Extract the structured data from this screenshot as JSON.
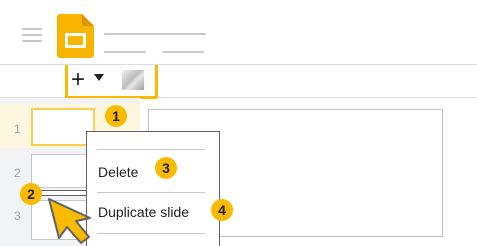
{
  "toolbar": {
    "new_slide_label": "+",
    "new_slide_menu_icon": "caret-down-icon",
    "layout_icon": "layout-thumbnail-icon"
  },
  "header": {
    "menu_icon": "hamburger-icon",
    "app_icon": "slides-logo-icon"
  },
  "filmstrip": {
    "slides": [
      {
        "number": "1"
      },
      {
        "number": "2"
      },
      {
        "number": "3"
      }
    ]
  },
  "context_menu": {
    "items": [
      {
        "label": "Delete"
      },
      {
        "label": "Duplicate slide"
      }
    ]
  },
  "callouts": [
    "1",
    "2",
    "3",
    "4"
  ],
  "colors": {
    "accent": "#f9ba00",
    "selection_bg": "#fef7e0",
    "border": "#dadce0"
  }
}
